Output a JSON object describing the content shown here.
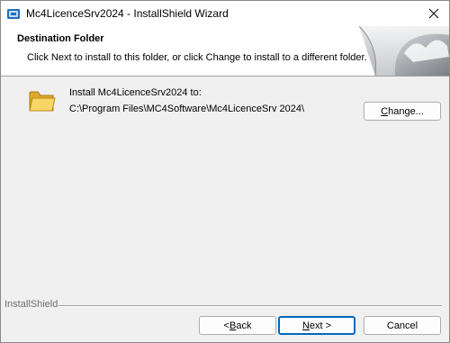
{
  "window": {
    "title": "Mc4LicenceSrv2024 - InstallShield Wizard",
    "app_icon": "installer-icon",
    "close_icon": "close-icon"
  },
  "header": {
    "title": "Destination Folder",
    "subtitle": "Click Next to install to this folder, or click Change to install to a different folder.",
    "art_icon": "page-curl-graphic"
  },
  "main": {
    "folder_icon": "folder-icon",
    "install_label": "Install Mc4LicenceSrv2024 to:",
    "install_path": "C:\\Program Files\\MC4Software\\Mc4LicenceSrv 2024\\",
    "change_button": {
      "accel": "C",
      "rest": "hange..."
    }
  },
  "footer": {
    "brand": "InstallShield",
    "back_button": {
      "prefix": "< ",
      "accel": "B",
      "rest": "ack"
    },
    "next_button": {
      "accel": "N",
      "rest": "ext >"
    },
    "cancel_button": "Cancel"
  },
  "colors": {
    "accent": "#0067c0",
    "header_bg": "#ffffff",
    "body_bg": "#f0f0f0"
  }
}
